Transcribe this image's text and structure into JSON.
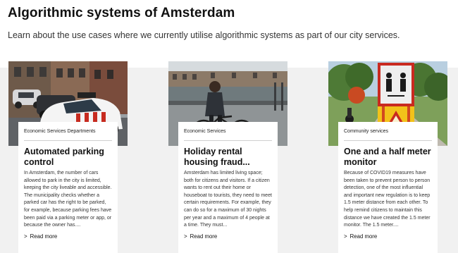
{
  "header": {
    "title": "Algorithmic systems of Amsterdam",
    "intro": "Learn about the use cases where we currently utilise algorithmic systems as part of our city services."
  },
  "cards": [
    {
      "tag": "Economic Services Departments",
      "title": "Automated parking control",
      "description": "In Amsterdam, the number of cars allowed to park in the city is limited, keeping the city liveable and accessible. The municipality checks whether a parked car has the right to be parked, for example, because parking fees have been paid via a parking meter or app, or because the owner has....",
      "read_more": "Read more",
      "image": "scan-car-on-street-photo"
    },
    {
      "tag": "Economic Services",
      "title": "Holiday rental housing fraud...",
      "description": "Amsterdam has limited living space; both for citizens and visitors. If a citizen wants to rent out their home or houseboat to tourists, they need to meet certain requirements. For example, they can do so for a maximum of 30 nights per year and a maximum of 4 people at a time. They must...",
      "read_more": "Read more",
      "image": "cyclist-on-canal-photo"
    },
    {
      "tag": "Community services",
      "title": "One and a half meter monitor",
      "description": "Because of COVID19 measures have been taken to prevent person to person detection, one of the most influential and important new regulation is to keep 1.5 meter distance from each other. To help remind citizens to maintain this distance we have created the 1.5 meter monitor. The 1.5 meter....",
      "read_more": "Read more",
      "image": "distance-sign-in-park-photo"
    }
  ]
}
